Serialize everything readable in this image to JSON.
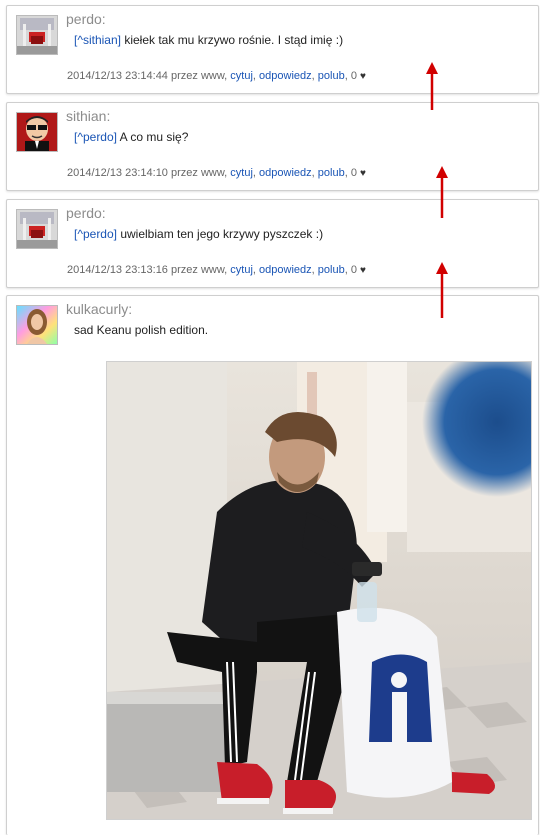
{
  "comments": [
    {
      "author": "perdo:",
      "reply_to": "[^sithian]",
      "text": " kiełek tak mu krzywo rośnie. I stąd imię :)",
      "timestamp": "2014/12/13 23:14:44 przez www,",
      "actions": {
        "cite": "cytuj",
        "reply": "odpowiedz",
        "like": "polub",
        "likes": "0"
      }
    },
    {
      "author": "sithian:",
      "reply_to": "[^perdo]",
      "text": " A co mu się?",
      "timestamp": "2014/12/13 23:14:10 przez www,",
      "actions": {
        "cite": "cytuj",
        "reply": "odpowiedz",
        "like": "polub",
        "likes": "0"
      }
    },
    {
      "author": "perdo:",
      "reply_to": "[^perdo]",
      "text": " uwielbiam ten jego krzywy pyszczek :)",
      "timestamp": "2014/12/13 23:13:16 przez www,",
      "actions": {
        "cite": "cytuj",
        "reply": "odpowiedz",
        "like": "polub",
        "likes": "0"
      }
    },
    {
      "author": "kulkacurly:",
      "text": "sad Keanu polish edition."
    }
  ],
  "colors": {
    "link": "#1a55b5",
    "arrow": "#d10000",
    "author": "#8c8c8c"
  },
  "icons": {
    "heart": "heart-icon",
    "arrow": "red-arrow-annotation"
  }
}
